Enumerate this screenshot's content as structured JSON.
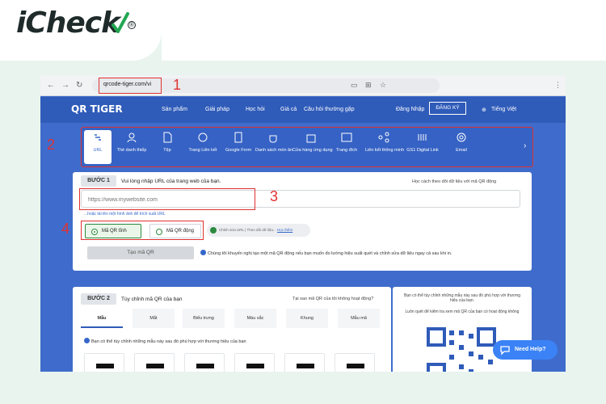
{
  "brand": {
    "name": "iCheck",
    "reg_mark": "®"
  },
  "browser": {
    "url": "qrcode-tiger.com/vi",
    "annotation_1": "1"
  },
  "site": {
    "logo": "QR TIGER",
    "menu": [
      "Sản phẩm",
      "Giải pháp",
      "Học hỏi",
      "Giá cả",
      "Câu hỏi thường gặp"
    ],
    "login": "Đăng Nhập",
    "register": "ĐĂNG KÝ",
    "language": "Tiếng Việt"
  },
  "types": {
    "annotation_2": "2",
    "items": [
      "URL",
      "Thẻ danh thiếp",
      "Tệp",
      "Trang Liên kết",
      "Google Form",
      "Danh sách món ăn",
      "Cửa hàng ứng dụng",
      "Trang đích",
      "Liên kết thông minh",
      "GS1 Digital Link",
      "Email"
    ]
  },
  "step1": {
    "badge": "BƯỚC 1",
    "title": "Vui lòng nhập URL của trang web của bạn.",
    "help": "Học cách theo dõi dữ liệu với mã QR động",
    "placeholder": "https://www.mywebsite.com",
    "annotation_3": "3",
    "annotation_4": "4",
    "sub_link": "...hoặc tải lên một hình ảnh để trích xuất URL",
    "static_label": "Mã QR tĩnh",
    "dynamic_label": "Mã QR động",
    "pill_text": "Chỉnh sửa URL | Theo dõi dữ liệu...",
    "pill_link": "Học thêm",
    "generate": "Tạo mã QR",
    "note": "Chúng tôi khuyến nghị tạo một mã QR động nếu bạn muốn đo lường hiệu suất quét và chỉnh sửa dữ liệu ngay cả sau khi in."
  },
  "step2": {
    "badge": "BƯỚC 2",
    "title": "Tùy chỉnh mã QR của bạn",
    "why": "Tại sao mã QR của tôi không hoạt động?",
    "tabs": [
      "Mẫu",
      "Mắt",
      "Biểu trưng",
      "Màu sắc",
      "Khung",
      "Mẫu mã"
    ],
    "note": "Bạn có thể tùy chỉnh những mẫu này sau đó phù hợp với thương hiệu của bạn"
  },
  "right": {
    "line1": "Bạn có thể tùy chỉnh những mẫu này sau đó phù hợp với thương hiệu của bạn.",
    "line2": "Luôn quét để kiểm tra xem mã QR của bạn có hoạt động không"
  },
  "help": {
    "label": "Need Help?"
  },
  "colors": {
    "brand_blue": "#2f5bb9",
    "accent_red": "#e03131",
    "green": "#2b8a3e"
  }
}
